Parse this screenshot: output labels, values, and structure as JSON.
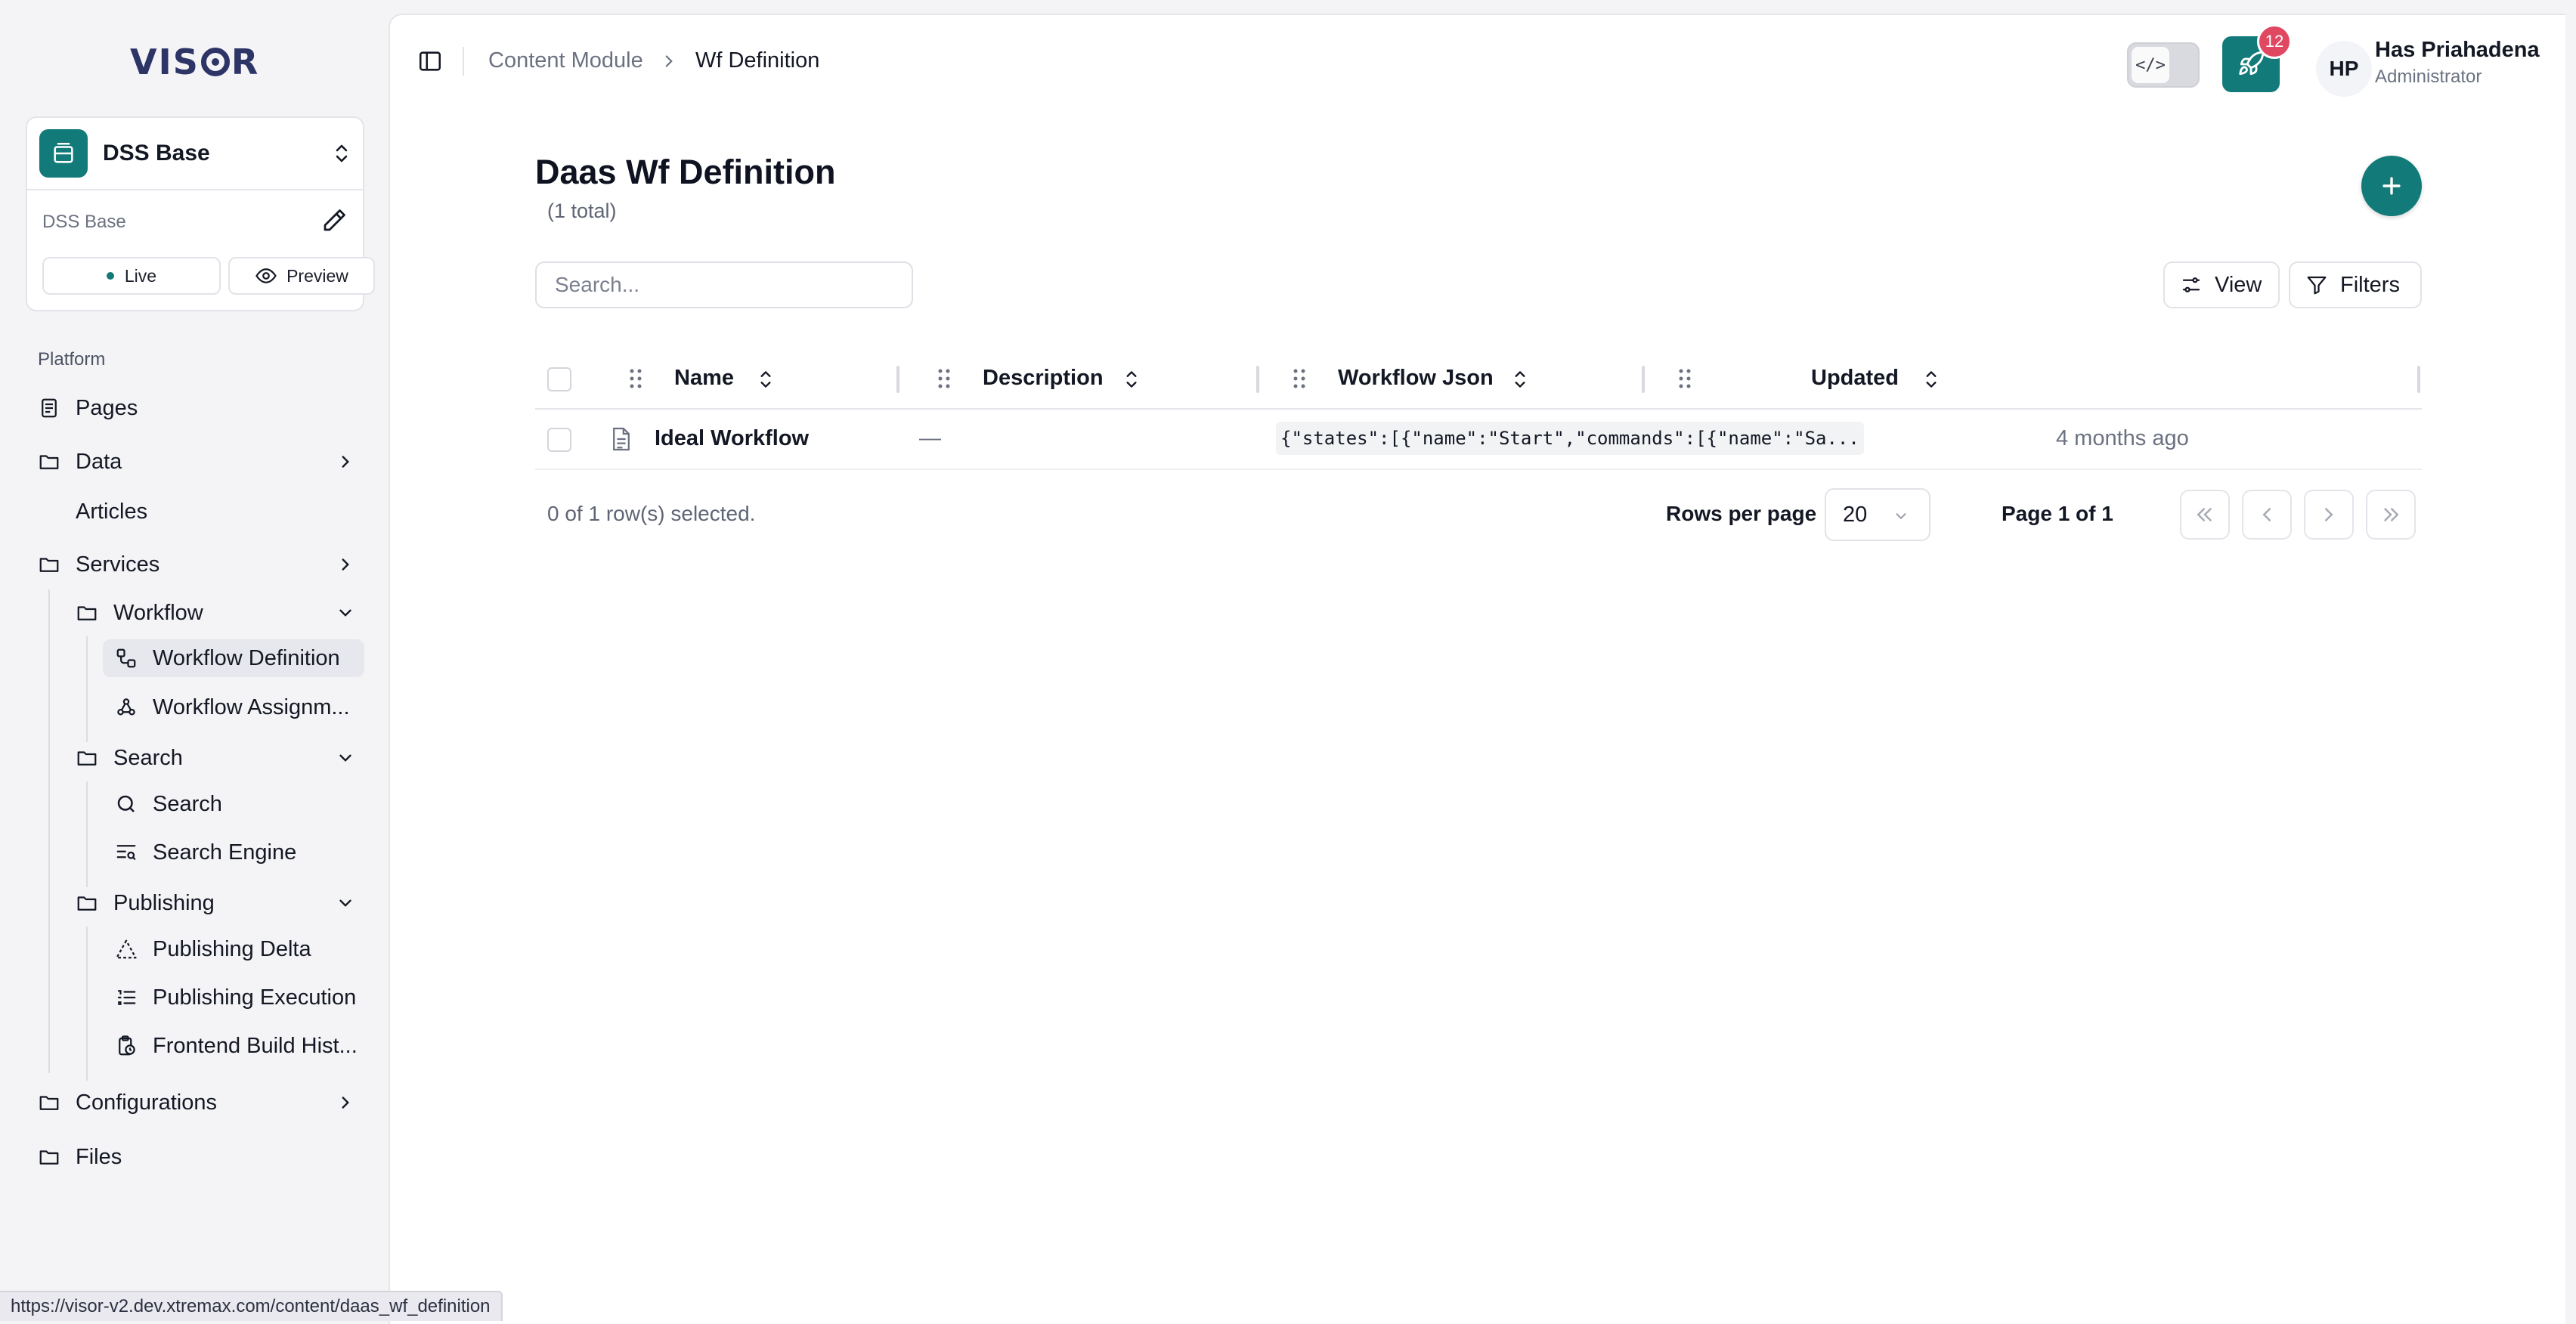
{
  "app": {
    "logo_text": "VISOR"
  },
  "workspace": {
    "name": "DSS Base",
    "subtitle": "DSS Base",
    "live_label": "Live",
    "preview_label": "Preview"
  },
  "sidebar": {
    "section_label": "Platform",
    "items": {
      "pages": "Pages",
      "data": "Data",
      "articles": "Articles",
      "services": "Services",
      "workflow": "Workflow",
      "workflow_definition": "Workflow Definition",
      "workflow_assignment": "Workflow Assignm...",
      "search_group": "Search",
      "search": "Search",
      "search_engine": "Search Engine",
      "publishing": "Publishing",
      "publishing_delta": "Publishing Delta",
      "publishing_execution": "Publishing Execution",
      "frontend_build": "Frontend Build Hist...",
      "configurations": "Configurations",
      "files": "Files"
    }
  },
  "breadcrumb": {
    "parent": "Content Module",
    "current": "Wf Definition"
  },
  "header": {
    "code_toggle_label": "</>",
    "notification_count": "12",
    "user_initials": "HP",
    "user_name": "Has Priahadena",
    "user_role": "Administrator"
  },
  "page": {
    "title": "Daas Wf Definition",
    "count": "(1 total)",
    "search_placeholder": "Search...",
    "view_label": "View",
    "filters_label": "Filters"
  },
  "table": {
    "columns": [
      "Name",
      "Description",
      "Workflow Json",
      "Updated"
    ],
    "rows": [
      {
        "name": "Ideal Workflow",
        "description": "—",
        "workflow_json": "{\"states\":[{\"name\":\"Start\",\"commands\":[{\"name\":\"Sa...",
        "updated": "4 months ago"
      }
    ]
  },
  "footer": {
    "selection": "0 of 1 row(s) selected.",
    "rows_per_page_label": "Rows per page",
    "rows_per_page_value": "20",
    "page_info": "Page 1 of 1"
  },
  "status_bar": {
    "url": "https://visor-v2.dev.xtremax.com/content/daas_wf_definition"
  },
  "colors": {
    "accent": "#127a78",
    "badge": "#e04862",
    "brand": "#2d3466"
  }
}
